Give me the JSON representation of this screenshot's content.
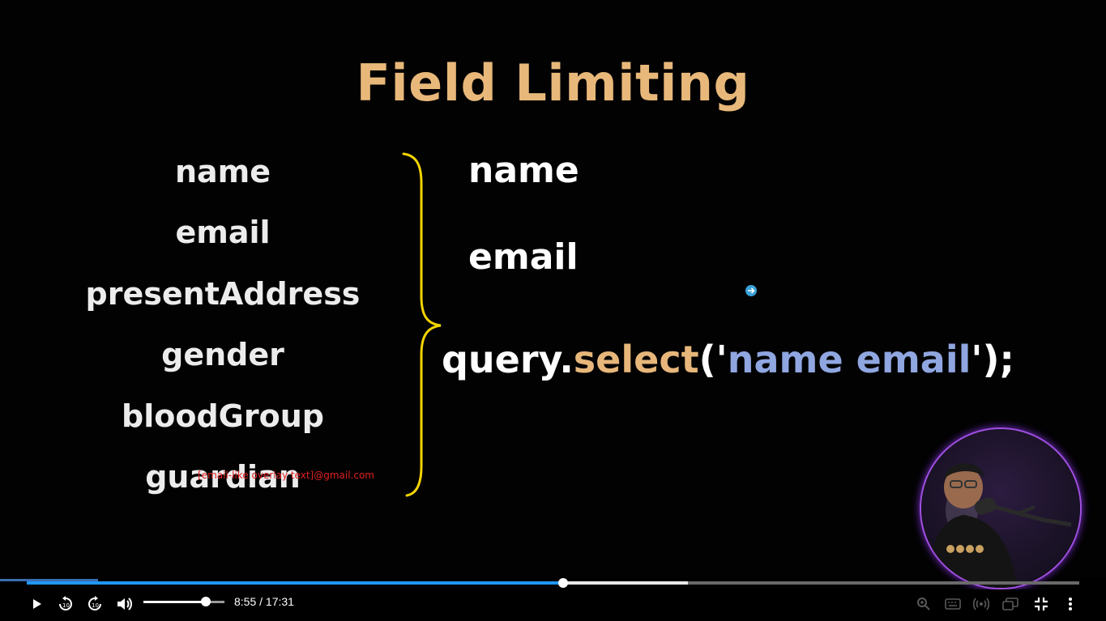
{
  "slide": {
    "title": "Field Limiting",
    "left_fields": [
      "name",
      "email",
      "presentAddress",
      "gender",
      "bloodGroup",
      "guardian"
    ],
    "selected_fields": [
      "name",
      "email"
    ],
    "query": {
      "prefix": "query.",
      "method": "select",
      "open": "('",
      "arg": "name email",
      "close": "');"
    },
    "watermark": "[email-like overlay text]@gmail.com"
  },
  "player": {
    "current_time": "8:55",
    "duration": "17:31",
    "time_display": "8:55 / 17:31",
    "progress_fraction": 0.51,
    "buffered_fraction": 0.63,
    "volume_fraction": 0.78,
    "colors": {
      "played": "#2196f3",
      "title": "#e8b87a",
      "method": "#e6b67a",
      "arg": "#8fa6e0"
    }
  }
}
